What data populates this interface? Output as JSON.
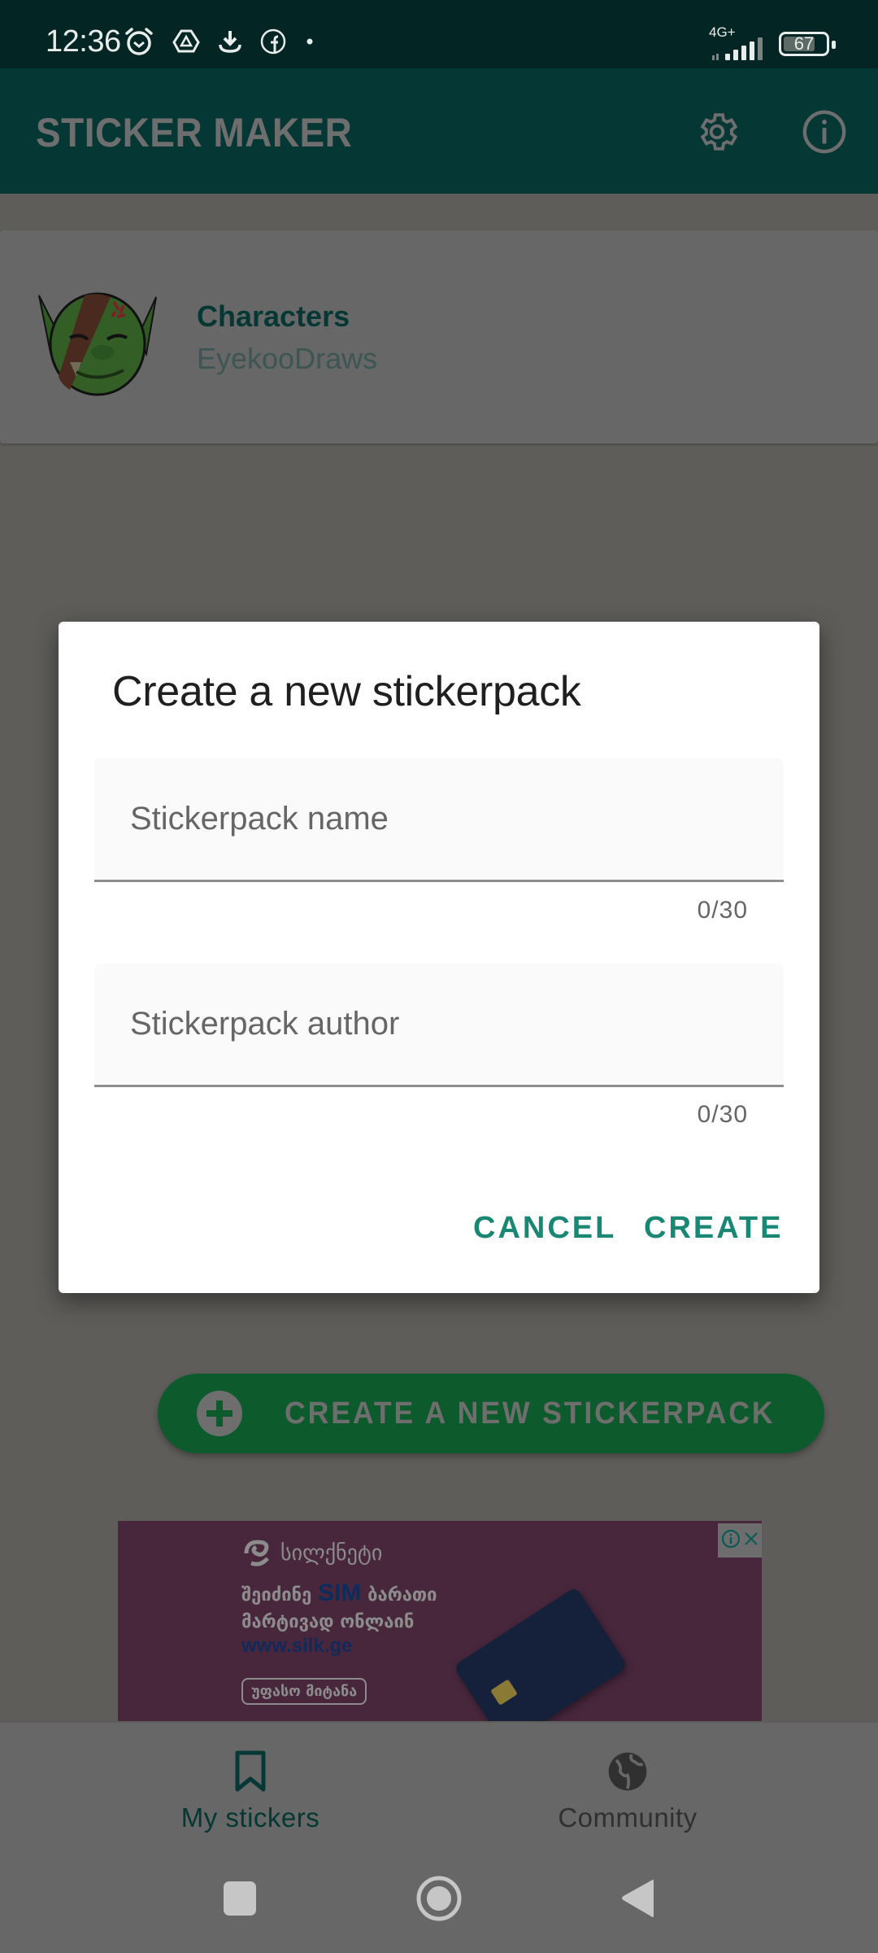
{
  "status_bar": {
    "time": "12:36",
    "notification_icons": [
      "alarm-icon",
      "drive-icon",
      "download-icon",
      "facebook-icon",
      "dot-icon"
    ],
    "network": "4G+",
    "signal_bars": 4,
    "battery_percent": "67"
  },
  "app_bar": {
    "title": "STICKER MAKER",
    "actions": [
      {
        "name": "settings",
        "icon": "gear-icon"
      },
      {
        "name": "info",
        "icon": "info-icon"
      }
    ]
  },
  "sticker_packs": [
    {
      "name": "Characters",
      "author": "EyekooDraws",
      "thumbnail": "orc-sticker"
    }
  ],
  "fab": {
    "label": "CREATE A NEW STICKERPACK",
    "icon": "plus-circle-icon"
  },
  "ad": {
    "brand": "სილქნეტი",
    "line1_pre": "შეიძინე",
    "line1_highlight": "SIM",
    "line1_post": "ბარათი",
    "line2": "მარტივად ონლაინ",
    "url": "www.silk.ge",
    "cta": "უფასო მიტანა",
    "controls": [
      "info-icon",
      "close-icon"
    ]
  },
  "dialog": {
    "title": "Create a new stickerpack",
    "fields": [
      {
        "placeholder": "Stickerpack name",
        "value": "",
        "counter": "0/30"
      },
      {
        "placeholder": "Stickerpack author",
        "value": "",
        "counter": "0/30"
      }
    ],
    "cancel_label": "CANCEL",
    "create_label": "CREATE"
  },
  "bottom_nav": {
    "items": [
      {
        "label": "My stickers",
        "icon": "bookmark-icon",
        "active": true
      },
      {
        "label": "Community",
        "icon": "globe-icon",
        "active": false
      }
    ]
  },
  "system_nav": {
    "buttons": [
      "recents",
      "home",
      "back"
    ]
  },
  "colors": {
    "status_bar": "#032523",
    "app_bar": "#053834",
    "accent": "#1a8774",
    "fab": "#0d5a2c",
    "scrim_bg": "#5e5d5a"
  }
}
